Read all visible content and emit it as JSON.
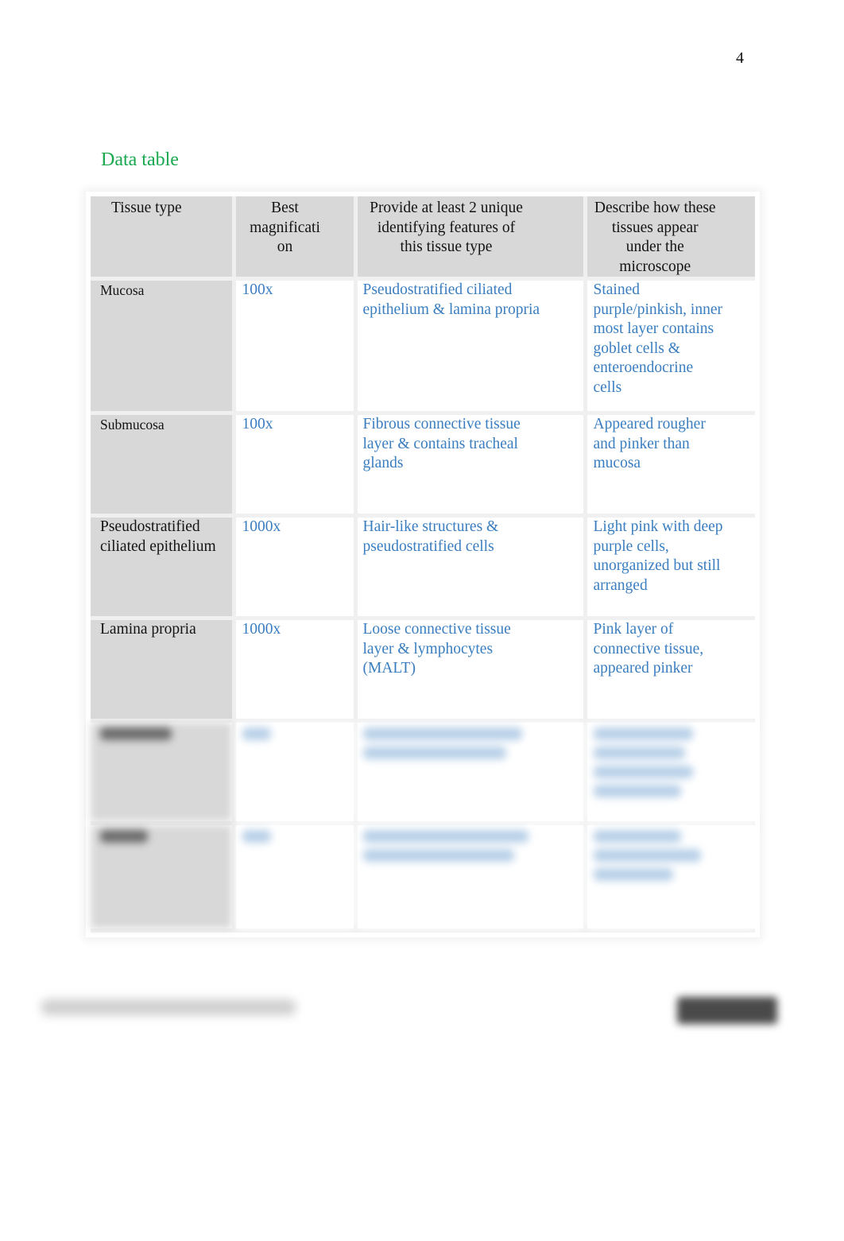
{
  "page": {
    "number": "4"
  },
  "section": {
    "title": "Data table"
  },
  "table": {
    "headers": [
      "Tissue type",
      "Best magnificati on",
      "Provide at least 2 unique identifying features of this tissue type",
      "Describe how these tissues appear under the microscope"
    ],
    "rows": [
      {
        "tissue": "Mucosa",
        "magnification": "100x",
        "features": "Pseudostratified ciliated epithelium & lamina propria",
        "appearance": "Stained purple/pinkish, inner most layer contains goblet cells & enteroendocrine cells"
      },
      {
        "tissue": "Submucosa",
        "magnification": "100x",
        "features": "Fibrous connective tissue layer & contains tracheal glands",
        "appearance": "Appeared rougher and pinker than mucosa"
      },
      {
        "tissue": "Pseudostratified ciliated epithelium",
        "magnification": "1000x",
        "features": "Hair-like structures & pseudostratified cells",
        "appearance": "Light pink with deep purple cells, unorganized but still arranged"
      },
      {
        "tissue": "Lamina propria",
        "magnification": "1000x",
        "features": "Loose connective tissue layer & lymphocytes (MALT)",
        "appearance": "Pink layer of connective tissue, appeared pinker"
      }
    ],
    "blurred_rows": 2
  },
  "colors": {
    "title_green": "#1aa84f",
    "answer_blue": "#3a7ec0",
    "header_gray": "#d8d8d8"
  }
}
